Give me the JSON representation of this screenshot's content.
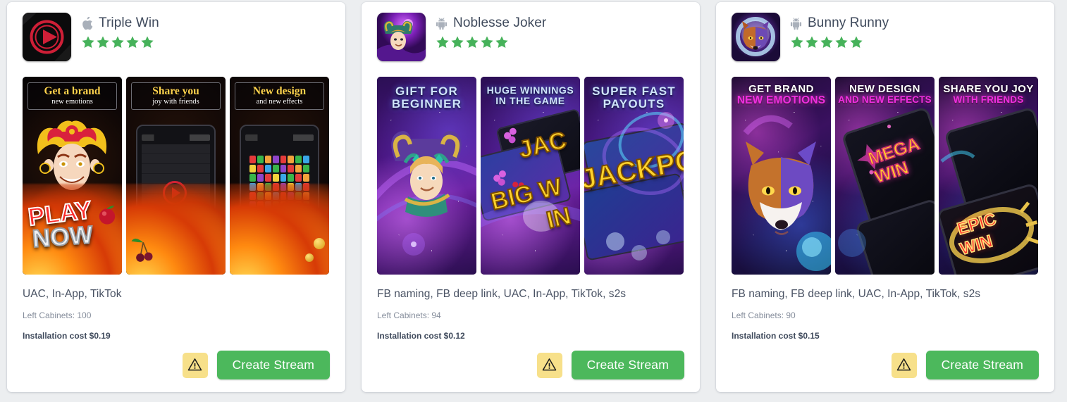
{
  "page": {
    "background_color": "#eceef0",
    "card_background": "#ffffff",
    "accent_green": "#4cb85c",
    "star_color": "#46b25a",
    "warning_bg": "#f7e08a",
    "title_color": "#3f4a5c"
  },
  "labels": {
    "create_stream": "Create Stream",
    "warning_icon": "warning-triangle-icon"
  },
  "cards": [
    {
      "platform_icon": "apple-icon",
      "app_title": "Triple Win",
      "rating": 5,
      "app_icon": "play-button-app-icon",
      "creatives": [
        {
          "line1": "Get a brand",
          "line2": "new emotions",
          "art": "joker-play-now"
        },
        {
          "line1": "Share you",
          "line2": "joy with friends",
          "art": "phone-video"
        },
        {
          "line1": "New design",
          "line2": "and new effects",
          "art": "phone-color-grid"
        }
      ],
      "tags": "UAC, In-App, TikTok",
      "left_cabinets": "Left Cabinets: 100",
      "installation_cost": "Installation cost $0.19",
      "create_stream": "Create Stream"
    },
    {
      "platform_icon": "android-icon",
      "app_title": "Noblesse Joker",
      "rating": 5,
      "app_icon": "joker-app-icon",
      "creatives": [
        {
          "line1": "GIFT FOR",
          "line2": "BEGINNER",
          "art": "joker-portrait"
        },
        {
          "line1": "HUGE WINNINGS",
          "line2": "IN THE GAME",
          "art": "big-win-phones"
        },
        {
          "line1": "SUPER FAST",
          "line2": "PAYOUTS",
          "art": "jackpot-phones"
        }
      ],
      "tags": "FB naming, FB deep link, UAC, In-App, TikTok, s2s",
      "left_cabinets": "Left Cabinets: 94",
      "installation_cost": "Installation cost $0.12",
      "create_stream": "Create Stream"
    },
    {
      "platform_icon": "android-icon",
      "app_title": "Bunny Runny",
      "rating": 5,
      "app_icon": "wolf-app-icon",
      "creatives": [
        {
          "line1": "GET BRAND",
          "line2": "NEW EMOTIONS",
          "art": "wolf-portrait"
        },
        {
          "line1": "NEW DESIGN",
          "line2": "AND NEW EFFECTS",
          "art": "mega-win-phone"
        },
        {
          "line1": "SHARE YOU JOY",
          "line2": "WITH FRIENDS",
          "art": "epic-win-phone"
        }
      ],
      "tags": "FB naming, FB deep link, UAC, In-App, TikTok, s2s",
      "left_cabinets": "Left Cabinets: 90",
      "installation_cost": "Installation cost $0.15",
      "create_stream": "Create Stream"
    }
  ],
  "creative_overlay_text": {
    "card1_shot1_big": "PLAY",
    "card1_shot1_big2": "NOW",
    "card2_shot2_big": "BIG WIN",
    "card2_shot2_big2": "JACKPOT",
    "card2_shot3_big": "JACKPOT",
    "card3_shot2_big": "MEGA WIN",
    "card3_shot3_big": "EPIC WIN"
  }
}
